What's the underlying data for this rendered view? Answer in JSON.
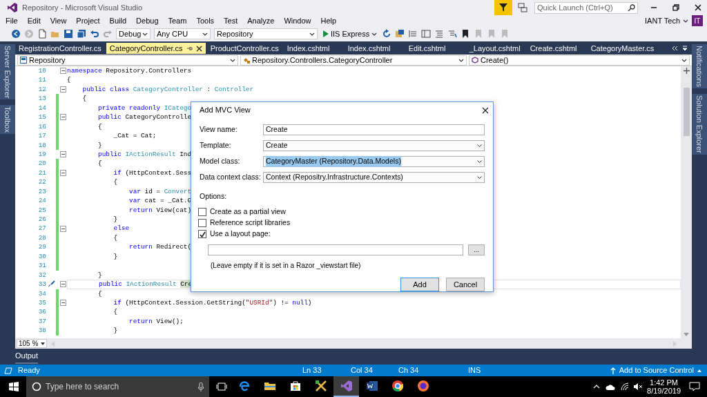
{
  "window": {
    "title": "Repository - Microsoft Visual Studio"
  },
  "quick_launch": {
    "placeholder": "Quick Launch (Ctrl+Q)"
  },
  "menu": [
    "File",
    "Edit",
    "View",
    "Project",
    "Build",
    "Debug",
    "Team",
    "Tools",
    "Test",
    "Analyze",
    "Window",
    "Help"
  ],
  "account": {
    "name": "IANT Tech",
    "initials": "IT"
  },
  "toolbar": {
    "configuration": "Debug",
    "platform": "Any CPU",
    "project": "Repository",
    "run_target": "IIS Express"
  },
  "side_tabs_left": [
    "Server Explorer",
    "Toolbox"
  ],
  "side_tabs_right": [
    "Notifications",
    "Solution Explorer"
  ],
  "tabs": [
    {
      "label": "RegistrationController.cs",
      "selected": false
    },
    {
      "label": "CategoryController.cs",
      "selected": true
    },
    {
      "label": "ProductController.cs",
      "selected": false
    },
    {
      "label": "Index.cshtml",
      "selected": false
    },
    {
      "label": "Index.cshtml",
      "selected": false
    },
    {
      "label": "Edit.cshtml",
      "selected": false
    },
    {
      "label": "_Layout.cshtml",
      "selected": false
    },
    {
      "label": "Create.cshtml",
      "selected": false
    },
    {
      "label": "CategoryMaster.cs",
      "selected": false
    }
  ],
  "nav_bar": {
    "project": "Repository",
    "type": "Repository.Controllers.CategoryController",
    "member": "Create()"
  },
  "editor": {
    "zoom": "105 %",
    "lines": [
      {
        "number": "10",
        "changed": false,
        "foldable": true,
        "current": false,
        "tokens": [
          {
            "kind": "kw",
            "text": "namespace"
          },
          {
            "kind": "plain",
            "text": " Repository.Controllers"
          }
        ]
      },
      {
        "number": "11",
        "changed": false,
        "foldable": false,
        "current": false,
        "tokens": [
          {
            "kind": "plain",
            "text": "{"
          }
        ]
      },
      {
        "number": "12",
        "changed": false,
        "foldable": true,
        "current": false,
        "tokens": [
          {
            "kind": "kw",
            "text": "    public class"
          },
          {
            "kind": "type",
            "text": " CategoryController"
          },
          {
            "kind": "plain",
            "text": " : "
          },
          {
            "kind": "type",
            "text": "Controller"
          }
        ]
      },
      {
        "number": "13",
        "changed": true,
        "foldable": false,
        "current": false,
        "tokens": [
          {
            "kind": "plain",
            "text": "    {"
          }
        ]
      },
      {
        "number": "14",
        "changed": true,
        "foldable": false,
        "current": false,
        "tokens": [
          {
            "kind": "kw",
            "text": "        private readonly"
          },
          {
            "kind": "type",
            "text": " ICatego"
          }
        ]
      },
      {
        "number": "15",
        "changed": true,
        "foldable": true,
        "current": false,
        "tokens": [
          {
            "kind": "kw",
            "text": "        public"
          },
          {
            "kind": "plain",
            "text": " CategoryControlle"
          }
        ]
      },
      {
        "number": "16",
        "changed": true,
        "foldable": false,
        "current": false,
        "tokens": [
          {
            "kind": "plain",
            "text": "        {"
          }
        ]
      },
      {
        "number": "17",
        "changed": true,
        "foldable": false,
        "current": false,
        "tokens": [
          {
            "kind": "plain",
            "text": "            _Cat = Cat;"
          }
        ]
      },
      {
        "number": "18",
        "changed": true,
        "foldable": false,
        "current": false,
        "tokens": [
          {
            "kind": "plain",
            "text": "        }"
          }
        ]
      },
      {
        "number": "19",
        "changed": false,
        "foldable": true,
        "current": false,
        "tokens": [
          {
            "kind": "kw",
            "text": "        public"
          },
          {
            "kind": "type",
            "text": " IActionResult"
          },
          {
            "kind": "plain",
            "text": " Ind"
          }
        ]
      },
      {
        "number": "20",
        "changed": true,
        "foldable": false,
        "current": false,
        "tokens": [
          {
            "kind": "plain",
            "text": "        {"
          }
        ]
      },
      {
        "number": "21",
        "changed": true,
        "foldable": true,
        "current": false,
        "tokens": [
          {
            "kind": "kw",
            "text": "            if"
          },
          {
            "kind": "plain",
            "text": " (HttpContext.Sess"
          }
        ]
      },
      {
        "number": "22",
        "changed": true,
        "foldable": false,
        "current": false,
        "tokens": [
          {
            "kind": "plain",
            "text": "            {"
          }
        ]
      },
      {
        "number": "23",
        "changed": true,
        "foldable": false,
        "current": false,
        "tokens": [
          {
            "kind": "kw",
            "text": "                var"
          },
          {
            "kind": "plain",
            "text": " id = "
          },
          {
            "kind": "type",
            "text": "Convert"
          }
        ]
      },
      {
        "number": "24",
        "changed": true,
        "foldable": false,
        "current": false,
        "tokens": [
          {
            "kind": "kw",
            "text": "                var"
          },
          {
            "kind": "plain",
            "text": " cat = _Cat.G"
          }
        ]
      },
      {
        "number": "25",
        "changed": true,
        "foldable": false,
        "current": false,
        "tokens": [
          {
            "kind": "kw",
            "text": "                return"
          },
          {
            "kind": "plain",
            "text": " View(cat)"
          }
        ]
      },
      {
        "number": "26",
        "changed": true,
        "foldable": false,
        "current": false,
        "tokens": [
          {
            "kind": "plain",
            "text": "            }"
          }
        ]
      },
      {
        "number": "27",
        "changed": true,
        "foldable": true,
        "current": false,
        "tokens": [
          {
            "kind": "kw",
            "text": "            else"
          }
        ]
      },
      {
        "number": "28",
        "changed": true,
        "foldable": false,
        "current": false,
        "tokens": [
          {
            "kind": "plain",
            "text": "            {"
          }
        ]
      },
      {
        "number": "29",
        "changed": true,
        "foldable": false,
        "current": false,
        "tokens": [
          {
            "kind": "kw",
            "text": "                return"
          },
          {
            "kind": "plain",
            "text": " Redirect("
          }
        ]
      },
      {
        "number": "30",
        "changed": true,
        "foldable": false,
        "current": false,
        "tokens": [
          {
            "kind": "plain",
            "text": "            }"
          }
        ]
      },
      {
        "number": "31",
        "changed": true,
        "foldable": false,
        "current": false
      },
      {
        "number": "32",
        "changed": false,
        "foldable": false,
        "current": false,
        "tokens": [
          {
            "kind": "plain",
            "text": "        }"
          }
        ]
      },
      {
        "number": "33",
        "changed": false,
        "foldable": true,
        "current": true,
        "tokens": [
          {
            "kind": "kw",
            "text": "        public"
          },
          {
            "kind": "type",
            "text": " IActionResult "
          },
          {
            "kind": "hl",
            "text": "Cre"
          }
        ]
      },
      {
        "number": "34",
        "changed": true,
        "foldable": false,
        "current": false,
        "tokens": [
          {
            "kind": "plain",
            "text": "        {"
          }
        ]
      },
      {
        "number": "35",
        "changed": true,
        "foldable": true,
        "current": false,
        "tokens": [
          {
            "kind": "kw",
            "text": "            if"
          },
          {
            "kind": "plain",
            "text": " (HttpContext.Session.GetString("
          },
          {
            "kind": "str",
            "text": "\"USRId\""
          },
          {
            "kind": "plain",
            "text": ") != "
          },
          {
            "kind": "kw",
            "text": "null"
          },
          {
            "kind": "plain",
            "text": ")"
          }
        ]
      },
      {
        "number": "36",
        "changed": true,
        "foldable": false,
        "current": false,
        "tokens": [
          {
            "kind": "plain",
            "text": "            {"
          }
        ]
      },
      {
        "number": "37",
        "changed": true,
        "foldable": false,
        "current": false,
        "tokens": [
          {
            "kind": "kw",
            "text": "                return"
          },
          {
            "kind": "plain",
            "text": " View();"
          }
        ]
      },
      {
        "number": "38",
        "changed": true,
        "foldable": false,
        "current": false,
        "tokens": [
          {
            "kind": "plain",
            "text": "            }"
          }
        ]
      }
    ]
  },
  "dialog": {
    "title": "Add MVC View",
    "fields": [
      {
        "label": "View name:",
        "kind": "text",
        "value": "Create",
        "highlighted": false
      },
      {
        "label": "Template:",
        "kind": "dropdown",
        "value": "Create",
        "highlighted": false
      },
      {
        "label": "Model class:",
        "kind": "dropdown",
        "value": "CategoryMaster (Repository.Data.Models)",
        "highlighted": true
      },
      {
        "label": "Data context class:",
        "kind": "dropdown",
        "value": "Context (Repositry.Infrastructure.Contexts)",
        "highlighted": false
      }
    ],
    "options_label": "Options:",
    "options": [
      {
        "label": "Create as a partial view",
        "checked": false
      },
      {
        "label": "Reference script libraries",
        "checked": false
      },
      {
        "label": "Use a layout page:",
        "checked": true
      }
    ],
    "browse_button": "...",
    "note": "(Leave empty if it is set in a Razor _viewstart file)",
    "buttons": [
      {
        "label": "Add",
        "default": true
      },
      {
        "label": "Cancel",
        "default": false
      }
    ]
  },
  "output_tab": "Output",
  "status_bar": {
    "state": "Ready",
    "line": "Ln 33",
    "column": "Col 34",
    "char": "Ch 34",
    "mode": "INS",
    "source_control": "Add to Source Control"
  },
  "taskbar": {
    "search_placeholder": "Type here to search",
    "apps": [
      {
        "kind": "edge",
        "active": false
      },
      {
        "kind": "explorer",
        "active": false
      },
      {
        "kind": "store",
        "active": false
      },
      {
        "kind": "tools",
        "active": false
      },
      {
        "kind": "vs",
        "active": true
      },
      {
        "kind": "word",
        "active": false
      },
      {
        "kind": "chrome",
        "active": false
      },
      {
        "kind": "firefox",
        "active": false
      }
    ],
    "time": "1:42 PM",
    "date": "8/19/2019"
  }
}
